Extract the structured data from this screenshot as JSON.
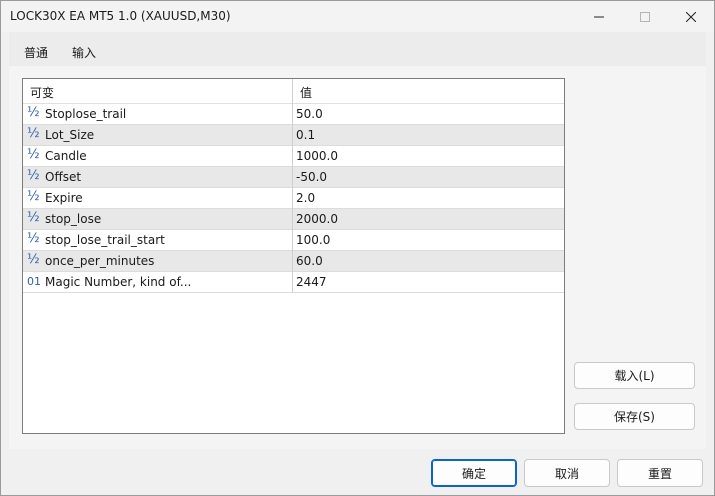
{
  "window": {
    "title": "LOCK30X EA MT5 1.0 (XAUUSD,M30)",
    "icons": {
      "minimize": "minimize-icon",
      "maximize": "maximize-icon",
      "close": "close-icon"
    }
  },
  "tabs": [
    {
      "label": "普通",
      "active": false
    },
    {
      "label": "输入",
      "active": true
    }
  ],
  "grid": {
    "headers": {
      "name": "可变",
      "value": "值"
    },
    "rows": [
      {
        "icon": "½",
        "name": "Stoplose_trail",
        "value": "50.0"
      },
      {
        "icon": "½",
        "name": "Lot_Size",
        "value": "0.1"
      },
      {
        "icon": "½",
        "name": "Candle",
        "value": "1000.0"
      },
      {
        "icon": "½",
        "name": "Offset",
        "value": "-50.0"
      },
      {
        "icon": "½",
        "name": "Expire",
        "value": "2.0"
      },
      {
        "icon": "½",
        "name": "stop_lose",
        "value": "2000.0"
      },
      {
        "icon": "½",
        "name": "stop_lose_trail_start",
        "value": "100.0"
      },
      {
        "icon": "½",
        "name": "once_per_minutes",
        "value": "60.0"
      },
      {
        "icon": "01",
        "name": "Magic Number, kind of...",
        "value": "2447"
      }
    ]
  },
  "side_buttons": {
    "load": "载入(L)",
    "save": "保存(S)"
  },
  "footer": {
    "ok": "确定",
    "cancel": "取消",
    "reset": "重置"
  },
  "colors": {
    "accent": "#0a64c8",
    "icon": "#3361a8",
    "alt_row": "#e8e8e8"
  }
}
